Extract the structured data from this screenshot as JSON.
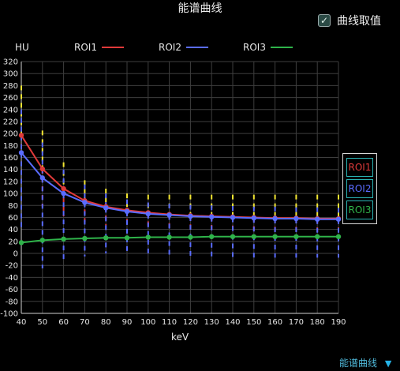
{
  "chart_data": {
    "type": "line",
    "title": "能谱曲线",
    "ylabel": "HU",
    "xlabel": "keV",
    "xlim": [
      40,
      190
    ],
    "ylim": [
      -100,
      320
    ],
    "x_ticks": [
      40,
      50,
      60,
      70,
      80,
      90,
      100,
      110,
      120,
      130,
      140,
      150,
      160,
      170,
      180,
      190
    ],
    "y_ticks": [
      -100,
      -80,
      -60,
      -40,
      -20,
      0,
      20,
      40,
      60,
      80,
      100,
      120,
      140,
      160,
      180,
      200,
      220,
      240,
      260,
      280,
      300,
      320
    ],
    "grid": true,
    "legend_position": "top",
    "x": [
      40,
      50,
      60,
      70,
      80,
      90,
      100,
      110,
      120,
      130,
      140,
      150,
      160,
      170,
      180,
      190
    ],
    "series": [
      {
        "name": "ROI1",
        "color": "#e03a3a",
        "values": [
          197,
          141,
          108,
          88,
          78,
          72,
          68,
          65,
          63,
          62,
          61,
          60,
          59,
          59,
          58,
          58
        ],
        "err_low": [
          115,
          78,
          62,
          52,
          47,
          44,
          40,
          38,
          36,
          35,
          34,
          33,
          32,
          32,
          31,
          31
        ],
        "err_high": [
          280,
          205,
          152,
          122,
          108,
          100,
          98,
          98,
          98,
          98,
          98,
          98,
          98,
          98,
          98,
          98
        ]
      },
      {
        "name": "ROI2",
        "color": "#5a6cff",
        "values": [
          168,
          126,
          100,
          85,
          76,
          70,
          66,
          64,
          62,
          61,
          60,
          59,
          58,
          58,
          57,
          57
        ],
        "err_low": [
          40,
          -25,
          -12,
          -5,
          0,
          0,
          -5,
          -5,
          -7,
          -7,
          -7,
          -7,
          -7,
          -7,
          -7,
          -7
        ],
        "err_high": [
          240,
          185,
          140,
          115,
          100,
          90,
          85,
          83,
          81,
          80,
          79,
          78,
          78,
          77,
          77,
          76
        ]
      },
      {
        "name": "ROI3",
        "color": "#2fb34a",
        "values": [
          18,
          22,
          24,
          25,
          26,
          26,
          27,
          27,
          27,
          28,
          28,
          28,
          28,
          28,
          28,
          28
        ]
      }
    ],
    "errorbar_color": "#f2e533"
  },
  "header": {
    "title": "能谱曲线",
    "checkbox_label": "曲线取值",
    "checkbox_checked": true
  },
  "roi_buttons": [
    {
      "label": "ROI1",
      "color": "#e03a3a"
    },
    {
      "label": "ROI2",
      "color": "#5a6cff"
    },
    {
      "label": "ROI3",
      "color": "#2fb34a"
    }
  ],
  "footer": {
    "label": "能谱曲线",
    "arrow": "▼"
  }
}
